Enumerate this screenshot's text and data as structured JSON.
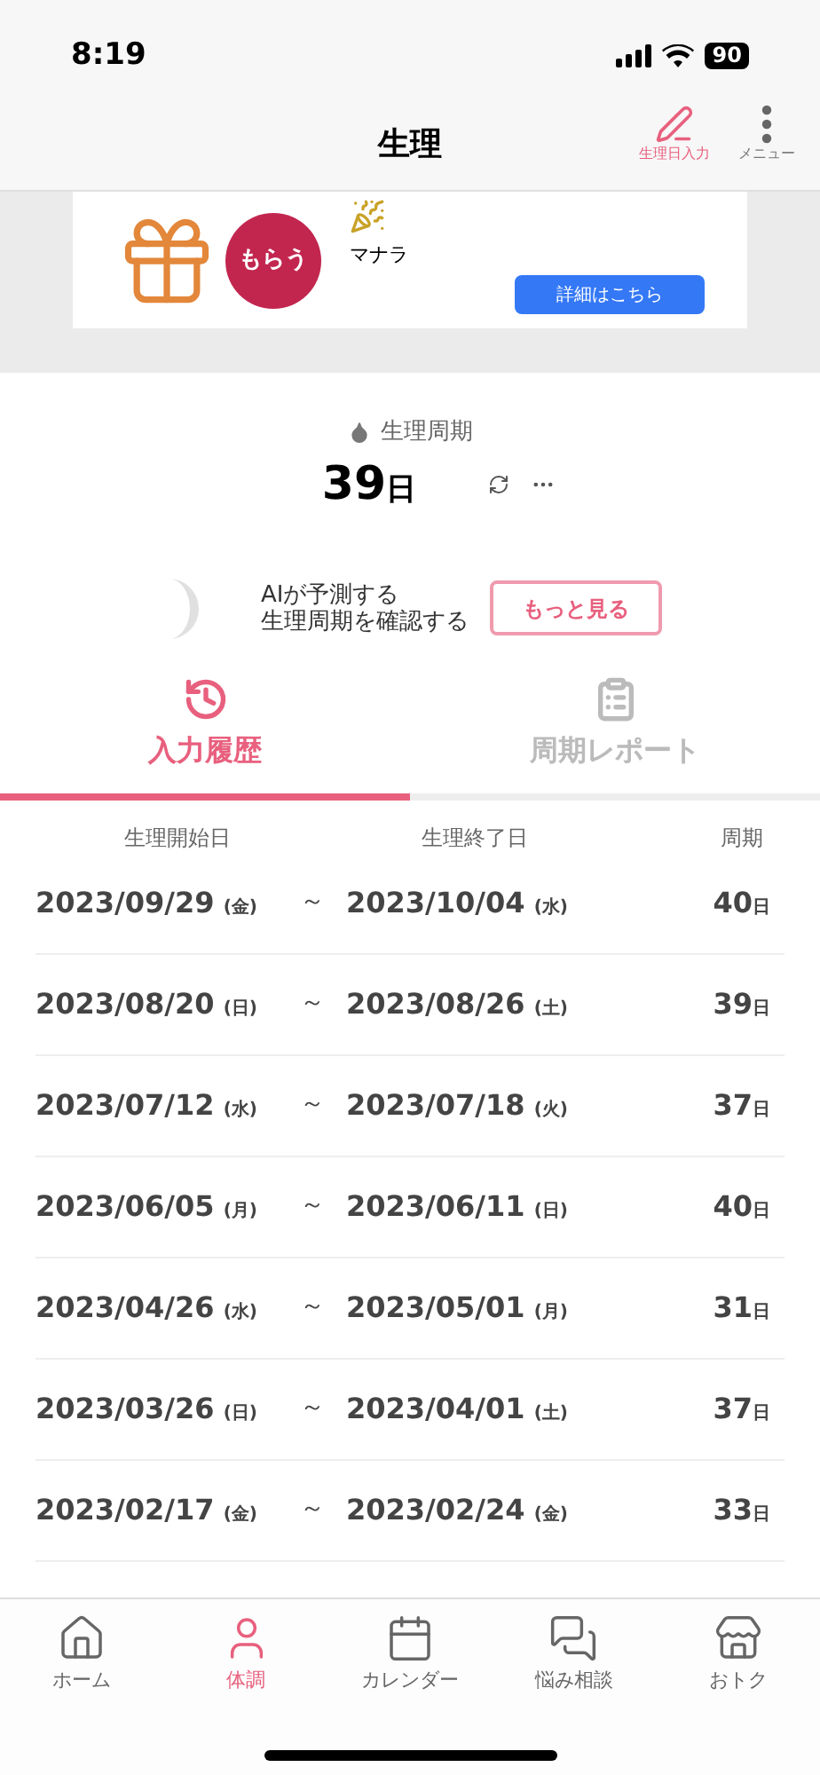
{
  "status_bar": {
    "time": "8:19",
    "battery": "90"
  },
  "header": {
    "title": "生理",
    "actions": [
      {
        "label": "生理日入力",
        "kind": "pen"
      },
      {
        "label": "メニュー",
        "kind": "menu"
      }
    ]
  },
  "ad": {
    "bubble": "もらう",
    "brand": "マナラ",
    "button": "詳細はこちら"
  },
  "cycle": {
    "label": "生理周期",
    "value": "39",
    "unit": "日"
  },
  "ai_prompt": {
    "text_line1": "AIが予測する",
    "text_line2": "生理周期を確認する",
    "button": "もっと見る"
  },
  "tabs": [
    {
      "label": "入力履歴",
      "kind": "history",
      "selected": true
    },
    {
      "label": "周期レポート",
      "kind": "report",
      "selected": false
    }
  ],
  "table": {
    "columns": [
      "生理開始日",
      "生理終了日",
      "周期"
    ],
    "rows": [
      {
        "start": "2023/09/29",
        "start_day": "(金)",
        "separator": "～",
        "end": "2023/10/04",
        "end_day": "(水)",
        "cycle": "40",
        "unit": "日"
      },
      {
        "start": "2023/08/20",
        "start_day": "(日)",
        "separator": "～",
        "end": "2023/08/26",
        "end_day": "(土)",
        "cycle": "39",
        "unit": "日"
      },
      {
        "start": "2023/07/12",
        "start_day": "(水)",
        "separator": "～",
        "end": "2023/07/18",
        "end_day": "(火)",
        "cycle": "37",
        "unit": "日"
      },
      {
        "start": "2023/06/05",
        "start_day": "(月)",
        "separator": "～",
        "end": "2023/06/11",
        "end_day": "(日)",
        "cycle": "40",
        "unit": "日"
      },
      {
        "start": "2023/04/26",
        "start_day": "(水)",
        "separator": "～",
        "end": "2023/05/01",
        "end_day": "(月)",
        "cycle": "31",
        "unit": "日"
      },
      {
        "start": "2023/03/26",
        "start_day": "(日)",
        "separator": "～",
        "end": "2023/04/01",
        "end_day": "(土)",
        "cycle": "37",
        "unit": "日"
      },
      {
        "start": "2023/02/17",
        "start_day": "(金)",
        "separator": "～",
        "end": "2023/02/24",
        "end_day": "(金)",
        "cycle": "33",
        "unit": "日"
      }
    ]
  },
  "bottom_nav": [
    {
      "label": "ホーム",
      "kind": "home",
      "selected": false
    },
    {
      "label": "体調",
      "kind": "body",
      "selected": true
    },
    {
      "label": "カレンダー",
      "kind": "calendar",
      "selected": false
    },
    {
      "label": "悩み相談",
      "kind": "chat",
      "selected": false
    },
    {
      "label": "おトク",
      "kind": "store",
      "selected": false
    }
  ]
}
